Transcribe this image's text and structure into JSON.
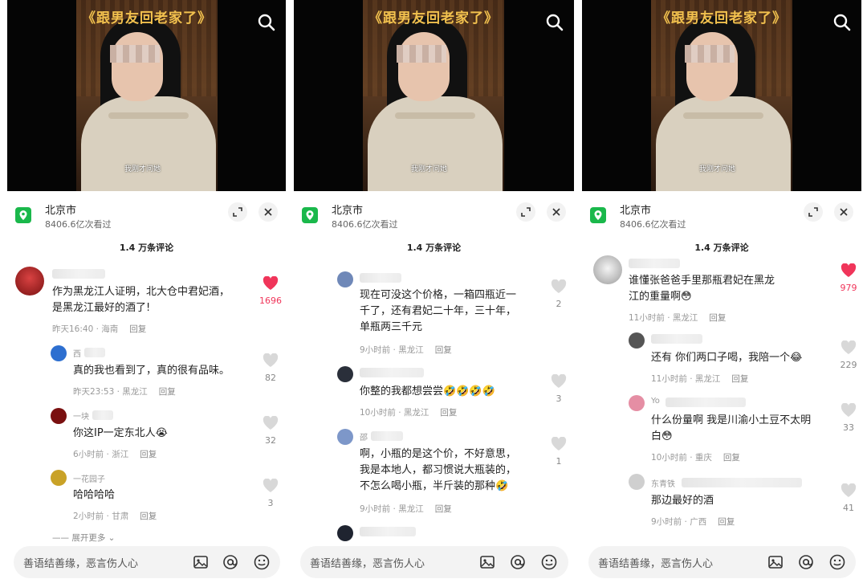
{
  "video_title": "《跟男友回老家了》",
  "subtitle": "我刚才问她",
  "sheet": {
    "city": "北京市",
    "views": "8406.6亿次看过",
    "comment_count": "1.4 万条评论"
  },
  "input_placeholder": "善语结善缘，恶言伤人心",
  "colors": {
    "like_red": "#f0355a",
    "location_green": "#1ab84b",
    "title_yellow": "#f2c14e"
  },
  "panels": [
    {
      "comments": [
        {
          "name": "",
          "text": [
            "作为黑龙江人证明，北大仓中君妃酒，",
            "是黑龙江最好的酒了!"
          ],
          "time": "昨天16:40 · 海南",
          "reply": "回复",
          "likes": "1696",
          "liked": true
        },
        {
          "name": "西",
          "text": [
            "真的我也看到了，真的很有品味。"
          ],
          "time": "昨天23:53 · 黑龙江",
          "reply": "回复",
          "likes": "82",
          "liked": false
        },
        {
          "name": "一块",
          "text": [
            "你这IP一定东北人😭"
          ],
          "time": "6小时前 · 浙江",
          "reply": "回复",
          "likes": "32",
          "liked": false
        },
        {
          "name": "一花园子",
          "text": [
            "哈哈哈哈"
          ],
          "time": "2小时前 · 甘肃",
          "reply": "回复",
          "likes": "3",
          "liked": false
        }
      ],
      "expand_more": "展开更多"
    },
    {
      "comments": [
        {
          "name": "",
          "text": [
            "现在可没这个价格，一箱四瓶近一",
            "千了，还有君妃二十年，三十年，",
            "单瓶两三千元"
          ],
          "time": "9小时前 · 黑龙江",
          "reply": "回复",
          "likes": "2",
          "liked": false
        },
        {
          "name": "",
          "text": [
            "你整的我都想尝尝🤣🤣🤣🤣"
          ],
          "time": "10小时前 · 黑龙江",
          "reply": "回复",
          "likes": "3",
          "liked": false
        },
        {
          "name": "邵",
          "text": [
            "啊，小瓶的是这个价，不好意思，",
            "我是本地人，都习惯说大瓶装的，",
            "不怎么喝小瓶，半斤装的那种🤣"
          ],
          "time": "9小时前 · 黑龙江",
          "reply": "回复",
          "likes": "1",
          "liked": false
        }
      ]
    },
    {
      "comments": [
        {
          "name": "",
          "text": [
            "谁懂张爸爸手里那瓶君妃在黑龙",
            "江的重量啊😳"
          ],
          "time": "11小时前 · 黑龙江",
          "reply": "回复",
          "likes": "979",
          "liked": true
        },
        {
          "name": "",
          "text": [
            "还有  你们两口子喝，我陪一个😂"
          ],
          "time": "11小时前 · 黑龙江",
          "reply": "回复",
          "likes": "229",
          "liked": false
        },
        {
          "name": "Yo",
          "text": [
            "什么份量啊 我是川渝小土豆不太明",
            "白😳"
          ],
          "time": "10小时前 · 重庆",
          "reply": "回复",
          "likes": "33",
          "liked": false
        },
        {
          "name": "东青铁",
          "text": [
            "那边最好的酒"
          ],
          "time": "9小时前 · 广西",
          "reply": "回复",
          "likes": "41",
          "liked": false
        }
      ]
    }
  ]
}
